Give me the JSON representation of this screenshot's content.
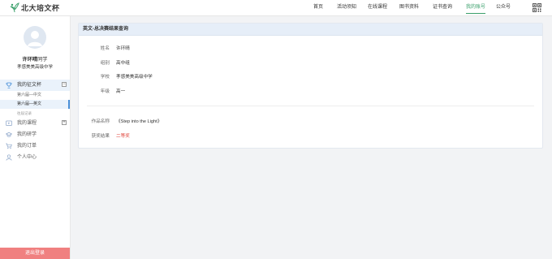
{
  "header": {
    "logo_text": "北大培文杯",
    "nav": [
      "首页",
      "活动须知",
      "在线课程",
      "图书资料",
      "证书查询",
      "我的账号",
      "公众号"
    ],
    "active_nav": "我的账号",
    "brand_color": "#3ba06b"
  },
  "sidebar": {
    "user_name": "许环晴",
    "user_suffix": "同学",
    "user_school": "孝感美美高级中学",
    "menu": {
      "works": "我的征文杯",
      "sub1": "第六届—中文",
      "sub2": "第六届—英文",
      "sub3": "往届记录",
      "courses": "我的课程",
      "study": "我的研学",
      "orders": "我的订单",
      "profile": "个人中心"
    },
    "logout": "退出登录"
  },
  "card": {
    "title": "英文-总决赛结果查询",
    "fields": {
      "name_label": "姓名",
      "name_value": "许环晴",
      "group_label": "组别",
      "group_value": "高中组",
      "school_label": "学校",
      "school_value": "孝感美美高级中学",
      "grade_label": "年级",
      "grade_value": "高一",
      "work_label": "作品名称",
      "work_value": "《Step into the Light》",
      "result_label": "获奖结果",
      "result_value": "二等奖"
    },
    "result_color": "#e0463c"
  }
}
